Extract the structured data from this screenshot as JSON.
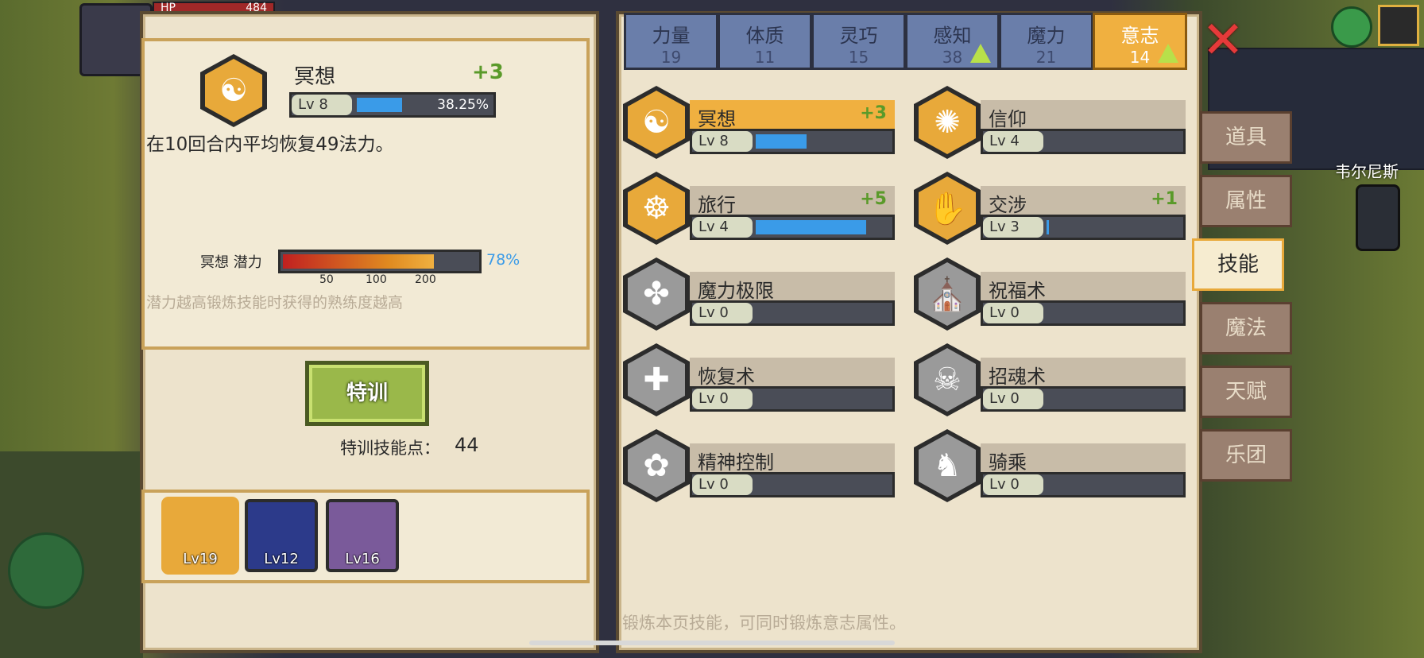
{
  "detail": {
    "skill_name": "冥想",
    "bonus": "+3",
    "level": "Lv 8",
    "progress_text": "38.25%",
    "progress": 0.3825,
    "description": "在10回合内平均恢复49法力。",
    "potential_label": "冥想 潜力",
    "potential_pct": "78%",
    "potential": 0.78,
    "potential_ticks": [
      "50",
      "100",
      "200"
    ],
    "potential_hint": "潜力越高锻炼技能时获得的熟练度越高",
    "train_button": "特训",
    "points_label": "特训技能点：",
    "points_value": "44"
  },
  "party": [
    {
      "level": "Lv19",
      "color": "#e8a93a",
      "selected": true
    },
    {
      "level": "Lv12",
      "color": "#2c3a8a",
      "selected": false
    },
    {
      "level": "Lv16",
      "color": "#7a5a9a",
      "selected": false
    }
  ],
  "tabs": [
    {
      "label": "力量",
      "value": "19",
      "up": false
    },
    {
      "label": "体质",
      "value": "11",
      "up": false
    },
    {
      "label": "灵巧",
      "value": "15",
      "up": false
    },
    {
      "label": "感知",
      "value": "38",
      "up": true
    },
    {
      "label": "魔力",
      "value": "21",
      "up": false
    },
    {
      "label": "意志",
      "value": "14",
      "up": true,
      "active": true
    }
  ],
  "skills": [
    {
      "name": "冥想",
      "bonus": "+3",
      "level": "Lv 8",
      "progress": 0.38,
      "icon": "meditation-icon",
      "glyph": "☯",
      "gold": true,
      "active": true
    },
    {
      "name": "信仰",
      "bonus": "",
      "level": "Lv 4",
      "progress": 0.0,
      "icon": "faith-icon",
      "glyph": "✺",
      "gold": true
    },
    {
      "name": "旅行",
      "bonus": "+5",
      "level": "Lv 4",
      "progress": 0.83,
      "icon": "travel-wheel-icon",
      "glyph": "☸",
      "gold": true
    },
    {
      "name": "交涉",
      "bonus": "+1",
      "level": "Lv 3",
      "progress": 0.02,
      "icon": "handshake-icon",
      "glyph": "✋",
      "gold": true
    },
    {
      "name": "魔力极限",
      "bonus": "",
      "level": "Lv 0",
      "progress": 0,
      "icon": "mana-limit-icon",
      "glyph": "✤",
      "gold": false
    },
    {
      "name": "祝福术",
      "bonus": "",
      "level": "Lv 0",
      "progress": 0,
      "icon": "praying-hands-icon",
      "glyph": "⛪",
      "gold": false
    },
    {
      "name": "恢复术",
      "bonus": "",
      "level": "Lv 0",
      "progress": 0,
      "icon": "healing-icon",
      "glyph": "✚",
      "gold": false
    },
    {
      "name": "招魂术",
      "bonus": "",
      "level": "Lv 0",
      "progress": 0,
      "icon": "skull-icon",
      "glyph": "☠",
      "gold": false
    },
    {
      "name": "精神控制",
      "bonus": "",
      "level": "Lv 0",
      "progress": 0,
      "icon": "brain-icon",
      "glyph": "✿",
      "gold": false
    },
    {
      "name": "骑乘",
      "bonus": "",
      "level": "Lv 0",
      "progress": 0,
      "icon": "horse-icon",
      "glyph": "♞",
      "gold": false
    }
  ],
  "right_hint": "锻炼本页技能，可同时锻炼意志属性。",
  "side_menu": [
    "道具",
    "属性",
    "技能",
    "魔法",
    "天赋",
    "乐团"
  ],
  "side_menu_active": "技能",
  "hud": {
    "hp_label": "HP",
    "hp_value": "484",
    "location": "韦尔尼斯"
  }
}
